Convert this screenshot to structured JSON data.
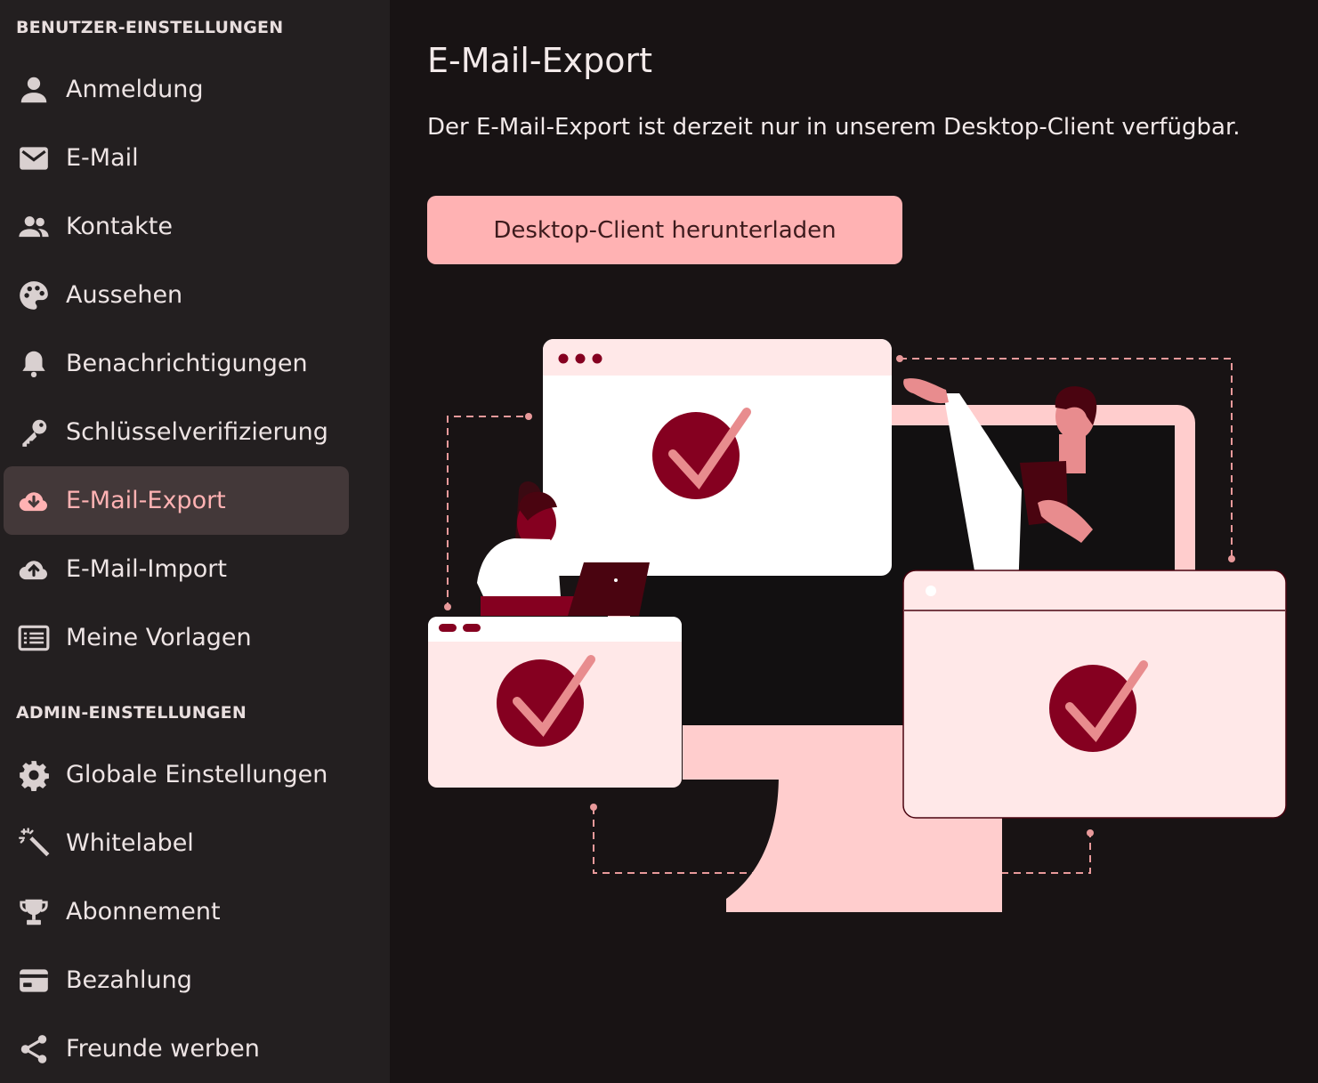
{
  "sidebar": {
    "user_section_title": "BENUTZER-EINSTELLUNGEN",
    "admin_section_title": "ADMIN-EINSTELLUNGEN",
    "user_items": [
      {
        "label": "Anmeldung",
        "icon": "person-icon"
      },
      {
        "label": "E-Mail",
        "icon": "envelope-icon"
      },
      {
        "label": "Kontakte",
        "icon": "people-icon"
      },
      {
        "label": "Aussehen",
        "icon": "palette-icon"
      },
      {
        "label": "Benachrichtigungen",
        "icon": "bell-icon"
      },
      {
        "label": "Schlüsselverifizierung",
        "icon": "key-icon"
      },
      {
        "label": "E-Mail-Export",
        "icon": "cloud-download-icon",
        "active": true
      },
      {
        "label": "E-Mail-Import",
        "icon": "cloud-upload-icon"
      },
      {
        "label": "Meine Vorlagen",
        "icon": "template-list-icon"
      }
    ],
    "admin_items": [
      {
        "label": "Globale Einstellungen",
        "icon": "gear-icon"
      },
      {
        "label": "Whitelabel",
        "icon": "magic-wand-icon"
      },
      {
        "label": "Abonnement",
        "icon": "trophy-icon"
      },
      {
        "label": "Bezahlung",
        "icon": "credit-card-icon"
      },
      {
        "label": "Freunde werben",
        "icon": "share-icon"
      }
    ]
  },
  "main": {
    "title": "E-Mail-Export",
    "description": "Der E-Mail-Export ist derzeit nur in unserem Desktop-Client verfügbar.",
    "download_button_label": "Desktop-Client herunterladen"
  },
  "colors": {
    "sidebar_bg": "#231f20",
    "main_bg": "#181314",
    "accent": "#ffb2b3",
    "active_item_bg": "#433839",
    "illustration_dark_red": "#850020",
    "illustration_light_pink": "#ffcdcd"
  }
}
